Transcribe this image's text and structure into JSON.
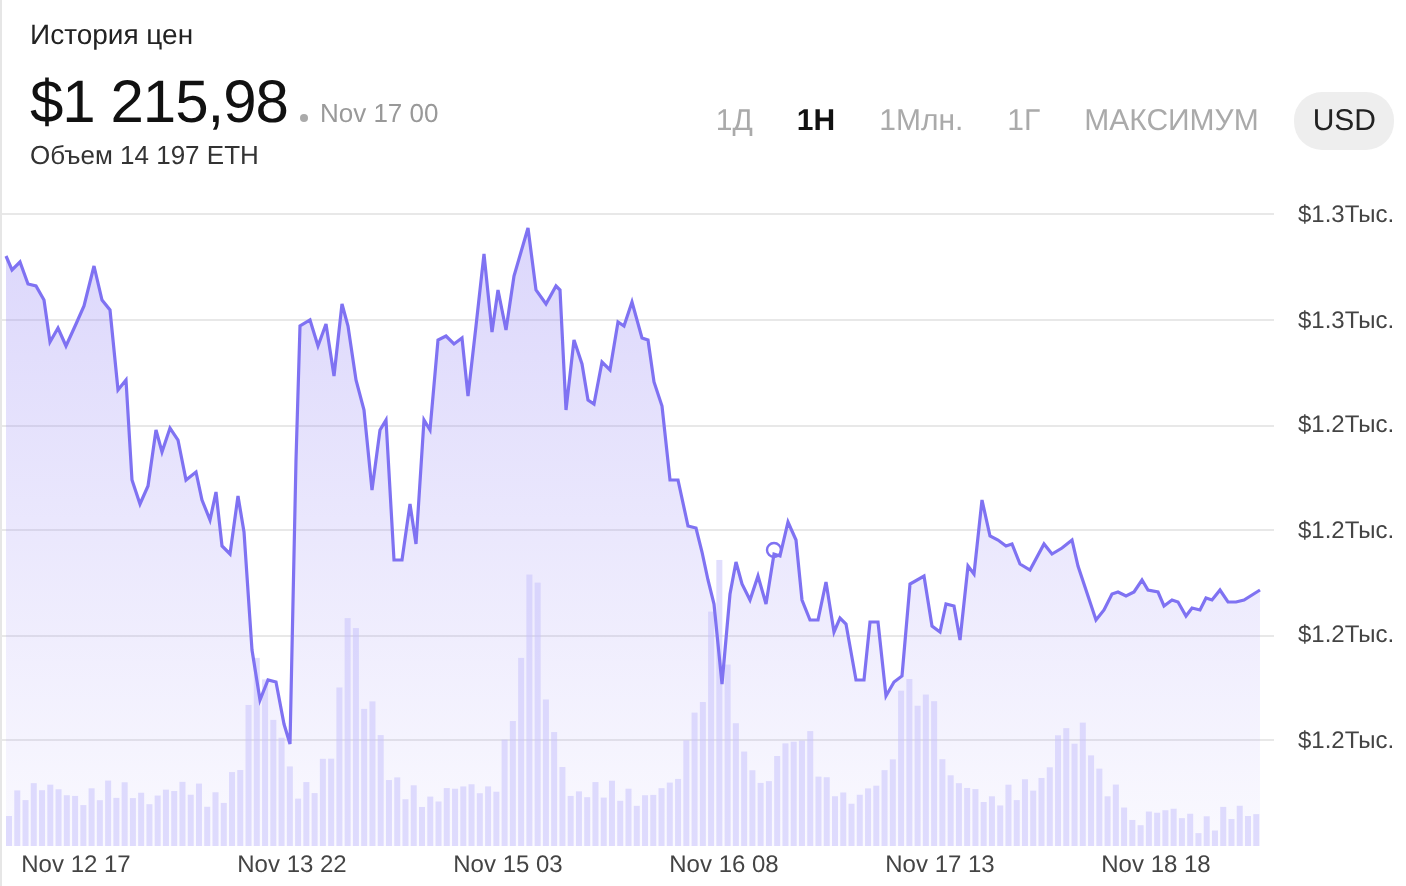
{
  "title": "История цен",
  "price": "$1 215,98",
  "timestamp": "Nov 17 00",
  "volume": "Объем 14 197 ETH",
  "ranges": [
    {
      "label": "1Д",
      "selected": false
    },
    {
      "label": "1Н",
      "selected": true
    },
    {
      "label": "1Млн.",
      "selected": false
    },
    {
      "label": "1Г",
      "selected": false
    },
    {
      "label": "МАКСИМУМ",
      "selected": false
    }
  ],
  "currency": "USD",
  "y_axis": [
    "$1.3Тыс.",
    "$1.3Тыс.",
    "$1.2Тыс.",
    "$1.2Тыс.",
    "$1.2Тыс.",
    "$1.2Тыс."
  ],
  "x_axis": [
    "Nov 12 17",
    "Nov 13 22",
    "Nov 15 03",
    "Nov 16 08",
    "Nov 17 13",
    "Nov 18 18"
  ]
}
